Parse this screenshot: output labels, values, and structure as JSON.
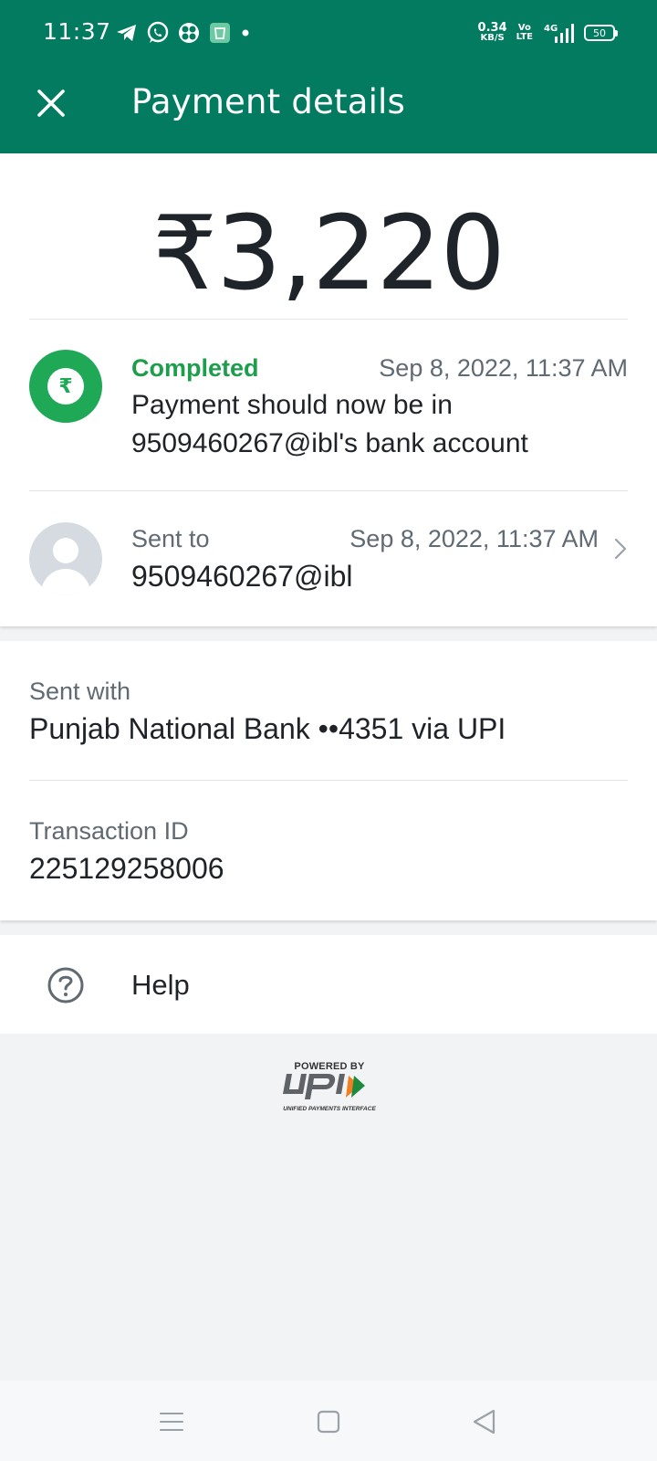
{
  "status_bar": {
    "time": "11:37",
    "net_speed": "0.34",
    "net_speed_unit": "KB/S",
    "volte_top": "Vo",
    "volte_bottom": "LTE",
    "network": "4G",
    "battery": "50",
    "notification_icons": [
      "telegram-icon",
      "whatsapp-icon",
      "app-icon",
      "shopping-icon",
      "dot-icon"
    ]
  },
  "header": {
    "title": "Payment details",
    "close_icon": "close-icon",
    "background": "#037b61"
  },
  "payment": {
    "amount": "₹3,220",
    "status": {
      "label": "Completed",
      "time": "Sep 8, 2022, 11:37 AM",
      "message": "Payment should now be in 9509460267@ibl's bank account",
      "color": "#1fa855"
    },
    "recipient": {
      "label": "Sent to",
      "time": "Sep 8, 2022, 11:37 AM",
      "id": "9509460267@ibl"
    }
  },
  "details": {
    "sent_with_label": "Sent with",
    "sent_with_value": "Punjab National Bank ••4351 via UPI",
    "transaction_id_label": "Transaction ID",
    "transaction_id_value": "225129258006"
  },
  "help": {
    "label": "Help",
    "icon": "help-icon"
  },
  "footer": {
    "powered_by": "POWERED BY",
    "upi_sub": "UNIFIED PAYMENTS INTERFACE"
  },
  "nav": [
    "menu-icon",
    "home-icon",
    "back-icon"
  ]
}
